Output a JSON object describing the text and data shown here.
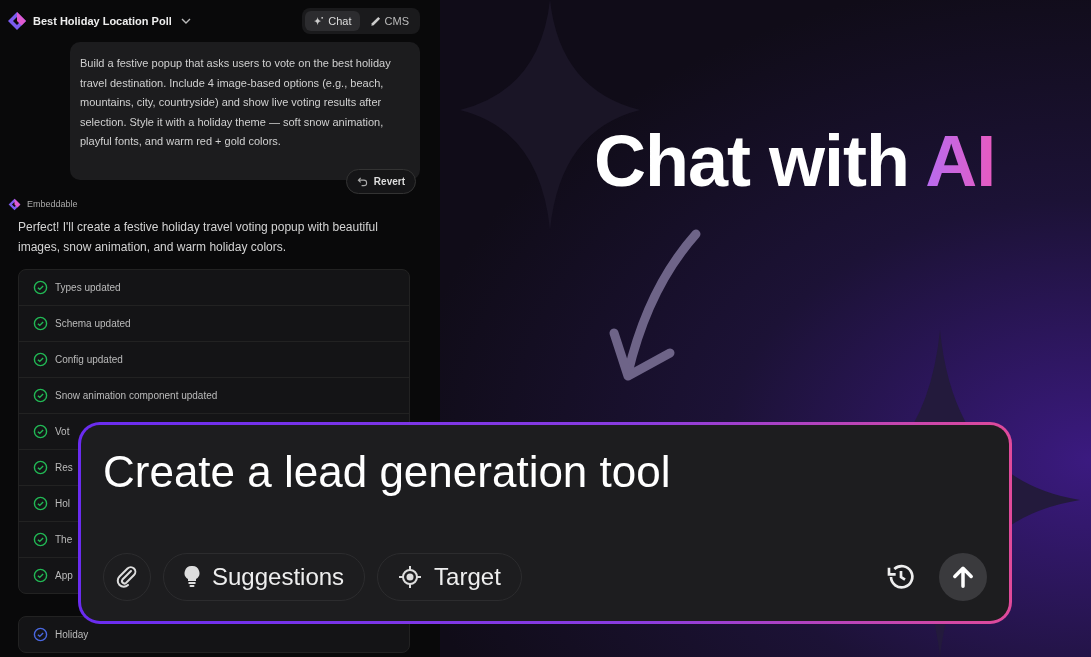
{
  "project": {
    "title": "Best Holiday Location Poll"
  },
  "modes": [
    {
      "label": "Chat",
      "kind": "chat",
      "selected": true
    },
    {
      "label": "CMS",
      "kind": "cms",
      "selected": false
    }
  ],
  "user_message": {
    "text": "Build a festive popup that asks users to vote on the best holiday travel destination. Include 4 image-based options (e.g., beach, mountains, city, countryside) and show live voting results after selection. Style it with a holiday theme — soft snow animation, playful fonts, and warm red + gold colors.",
    "action": "Revert"
  },
  "assistant": {
    "name": "Embeddable",
    "text": "Perfect! I'll create a festive holiday travel voting popup with beautiful images, snow animation, and warm holiday colors."
  },
  "steps": [
    {
      "label": "Types updated",
      "done": true
    },
    {
      "label": "Schema updated",
      "done": true
    },
    {
      "label": "Config updated",
      "done": true
    },
    {
      "label": "Snow animation component updated",
      "done": true
    },
    {
      "label": "Vot",
      "done": true
    },
    {
      "label": "Res",
      "done": true
    },
    {
      "label": "Hol",
      "done": true
    },
    {
      "label": "The",
      "done": true
    },
    {
      "label": "App",
      "done": true
    }
  ],
  "next_steps": [
    {
      "label": "Holiday",
      "done": false
    }
  ],
  "headline": {
    "text": "Chat with",
    "highlight": "AI"
  },
  "prompt": {
    "value": "Create a lead generation tool",
    "buttons": [
      {
        "label": "Suggestions",
        "kind": "bulb"
      },
      {
        "label": "Target",
        "kind": "target"
      }
    ]
  }
}
